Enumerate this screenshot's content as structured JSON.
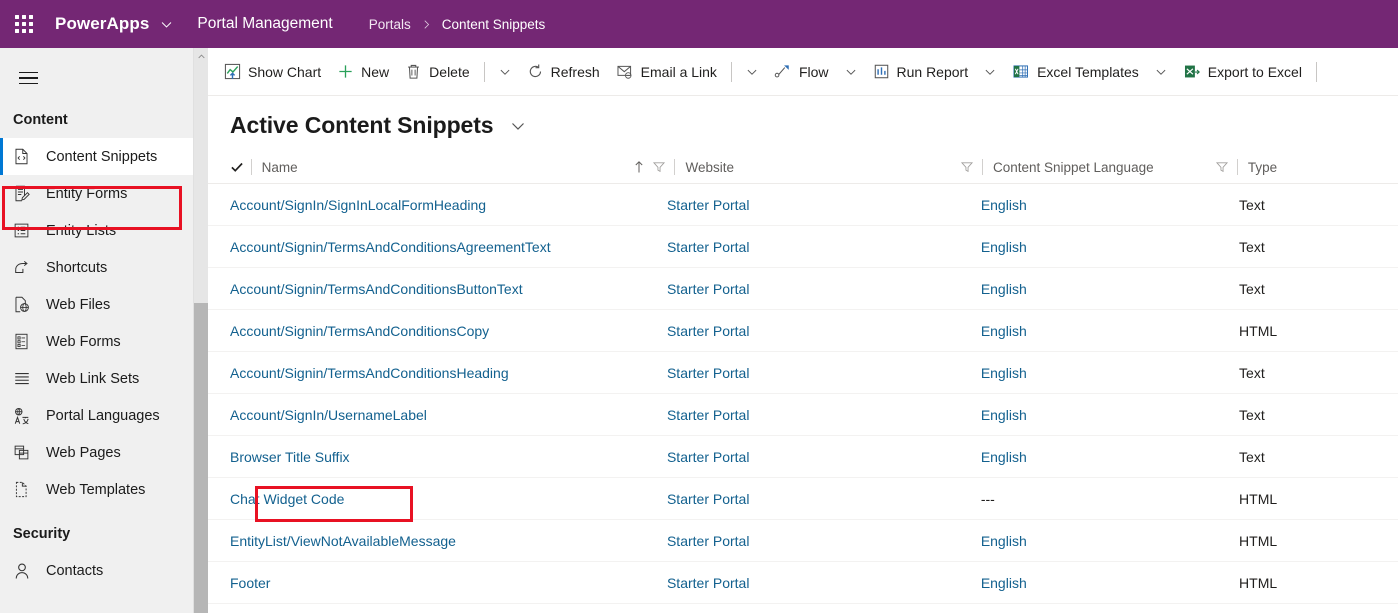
{
  "topbar": {
    "waffle_icon": "app-launcher-icon",
    "brand": "PowerApps",
    "brand_caret_icon": "chevron-down-icon",
    "app_name": "Portal Management",
    "breadcrumb": {
      "parent": "Portals",
      "separator_icon": "chevron-right-icon",
      "current": "Content Snippets"
    },
    "bg_color": "#742774"
  },
  "sidebar": {
    "hamburger_icon": "hamburger-menu-icon",
    "scroll_up_icon": "chevron-up-icon",
    "groups": [
      {
        "title": "Content",
        "items": [
          {
            "label": "Content Snippets",
            "icon": "code-document-icon",
            "selected": true
          },
          {
            "label": "Entity Forms",
            "icon": "form-edit-icon",
            "selected": false
          },
          {
            "label": "Entity Lists",
            "icon": "list-icon",
            "selected": false
          },
          {
            "label": "Shortcuts",
            "icon": "shortcut-arrow-icon",
            "selected": false
          },
          {
            "label": "Web Files",
            "icon": "file-globe-icon",
            "selected": false
          },
          {
            "label": "Web Forms",
            "icon": "web-form-icon",
            "selected": false
          },
          {
            "label": "Web Link Sets",
            "icon": "lines-icon",
            "selected": false
          },
          {
            "label": "Portal Languages",
            "icon": "language-icon",
            "selected": false
          },
          {
            "label": "Web Pages",
            "icon": "pages-icon",
            "selected": false
          },
          {
            "label": "Web Templates",
            "icon": "template-dashed-icon",
            "selected": false
          }
        ]
      },
      {
        "title": "Security",
        "items": [
          {
            "label": "Contacts",
            "icon": "person-icon",
            "selected": false
          }
        ]
      }
    ]
  },
  "commandbar": {
    "items": [
      {
        "label": "Show Chart",
        "icon": "show-chart-icon",
        "type": "button"
      },
      {
        "label": "New",
        "icon": "plus-icon",
        "type": "button"
      },
      {
        "label": "Delete",
        "icon": "trash-icon",
        "type": "button"
      },
      {
        "label": "",
        "icon": "chevron-down-icon",
        "type": "caret"
      },
      {
        "label": "",
        "icon": "divider",
        "type": "divider-before-caret"
      },
      {
        "label": "Refresh",
        "icon": "refresh-icon",
        "type": "button"
      },
      {
        "label": "Email a Link",
        "icon": "email-link-icon",
        "type": "button"
      },
      {
        "label": "",
        "icon": "chevron-down-icon",
        "type": "caret"
      },
      {
        "label": "Flow",
        "icon": "flow-icon",
        "type": "button"
      },
      {
        "label": "",
        "icon": "chevron-down-icon",
        "type": "caret"
      },
      {
        "label": "Run Report",
        "icon": "report-icon",
        "type": "button"
      },
      {
        "label": "",
        "icon": "chevron-down-icon",
        "type": "caret"
      },
      {
        "label": "Excel Templates",
        "icon": "excel-template-icon",
        "type": "button"
      },
      {
        "label": "",
        "icon": "chevron-down-icon",
        "type": "caret"
      },
      {
        "label": "Export to Excel",
        "icon": "excel-export-icon",
        "type": "button"
      }
    ],
    "labels": {
      "show_chart": "Show Chart",
      "new": "New",
      "delete": "Delete",
      "refresh": "Refresh",
      "email_a_link": "Email a Link",
      "flow": "Flow",
      "run_report": "Run Report",
      "excel_templates": "Excel Templates",
      "export_to_excel": "Export to Excel"
    }
  },
  "view": {
    "title": "Active Content Snippets",
    "caret_icon": "chevron-down-icon"
  },
  "grid": {
    "select_all_icon": "checkmark-icon",
    "columns": [
      {
        "label": "Name",
        "sorted": true,
        "sort_icon": "arrow-up-icon",
        "filter_icon": "filter-icon"
      },
      {
        "label": "Website",
        "sorted": false,
        "filter_icon": "filter-icon"
      },
      {
        "label": "Content Snippet Language",
        "sorted": false,
        "filter_icon": "filter-icon"
      },
      {
        "label": "Type",
        "sorted": false,
        "filter_icon": null
      }
    ],
    "rows": [
      {
        "name": "Account/SignIn/SignInLocalFormHeading",
        "website": "Starter Portal",
        "language": "English",
        "type": "Text",
        "highlighted": false
      },
      {
        "name": "Account/Signin/TermsAndConditionsAgreementText",
        "website": "Starter Portal",
        "language": "English",
        "type": "Text",
        "highlighted": false
      },
      {
        "name": "Account/Signin/TermsAndConditionsButtonText",
        "website": "Starter Portal",
        "language": "English",
        "type": "Text",
        "highlighted": false
      },
      {
        "name": "Account/Signin/TermsAndConditionsCopy",
        "website": "Starter Portal",
        "language": "English",
        "type": "HTML",
        "highlighted": false
      },
      {
        "name": "Account/Signin/TermsAndConditionsHeading",
        "website": "Starter Portal",
        "language": "English",
        "type": "Text",
        "highlighted": false
      },
      {
        "name": "Account/SignIn/UsernameLabel",
        "website": "Starter Portal",
        "language": "English",
        "type": "Text",
        "highlighted": false
      },
      {
        "name": "Browser Title Suffix",
        "website": "Starter Portal",
        "language": "English",
        "type": "Text",
        "highlighted": false
      },
      {
        "name": "Chat Widget Code",
        "website": "Starter Portal",
        "language": "---",
        "type": "HTML",
        "highlighted": true
      },
      {
        "name": "EntityList/ViewNotAvailableMessage",
        "website": "Starter Portal",
        "language": "English",
        "type": "HTML",
        "highlighted": false
      },
      {
        "name": "Footer",
        "website": "Starter Portal",
        "language": "English",
        "type": "HTML",
        "highlighted": false
      }
    ]
  },
  "annotations": {
    "highlight_color": "#e81123",
    "accent_color": "#0078d4",
    "link_color": "#13618f"
  }
}
